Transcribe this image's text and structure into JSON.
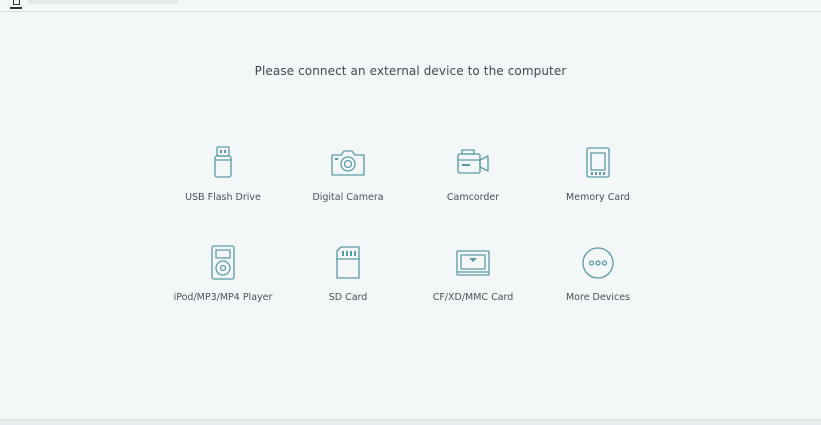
{
  "prompt": "Please connect an external device to the computer",
  "accent_color": "#5a9aa6",
  "devices": [
    {
      "label": "USB Flash Drive",
      "icon": "usb-flash-drive-icon"
    },
    {
      "label": "Digital Camera",
      "icon": "digital-camera-icon"
    },
    {
      "label": "Camcorder",
      "icon": "camcorder-icon"
    },
    {
      "label": "Memory Card",
      "icon": "memory-card-icon"
    },
    {
      "label": "iPod/MP3/MP4 Player",
      "icon": "media-player-icon"
    },
    {
      "label": "SD Card",
      "icon": "sd-card-icon"
    },
    {
      "label": "CF/XD/MMC Card",
      "icon": "cf-card-icon"
    },
    {
      "label": "More Devices",
      "icon": "more-devices-icon"
    }
  ]
}
